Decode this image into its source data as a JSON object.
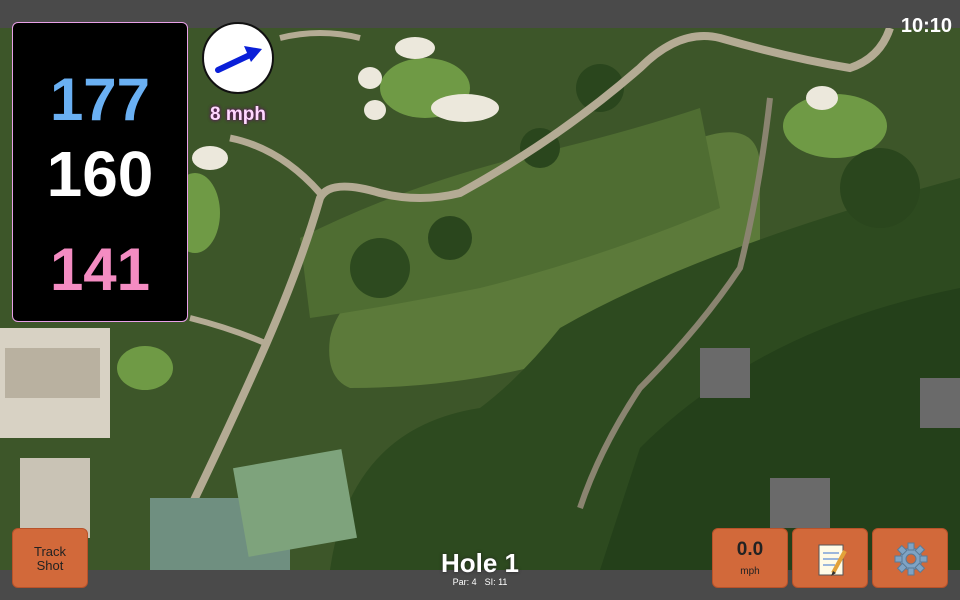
{
  "status": {
    "time": "10:10"
  },
  "distances": {
    "back": "177",
    "middle": "160",
    "front": "141"
  },
  "wind": {
    "speed_label": "8 mph",
    "direction_icon": "wind-arrow-icon"
  },
  "hole": {
    "title": "Hole 1",
    "par": "Par: 4",
    "si": "SI: 11"
  },
  "buttons": {
    "track_shot_line1": "Track",
    "track_shot_line2": "Shot",
    "wind_value": "0.0",
    "wind_unit": "mph",
    "notes_icon": "notepad-icon",
    "settings_icon": "gear-icon"
  },
  "colors": {
    "back": "#6ab0f3",
    "middle": "#ffffff",
    "front": "#f48cc2",
    "button": "#d2693a"
  }
}
